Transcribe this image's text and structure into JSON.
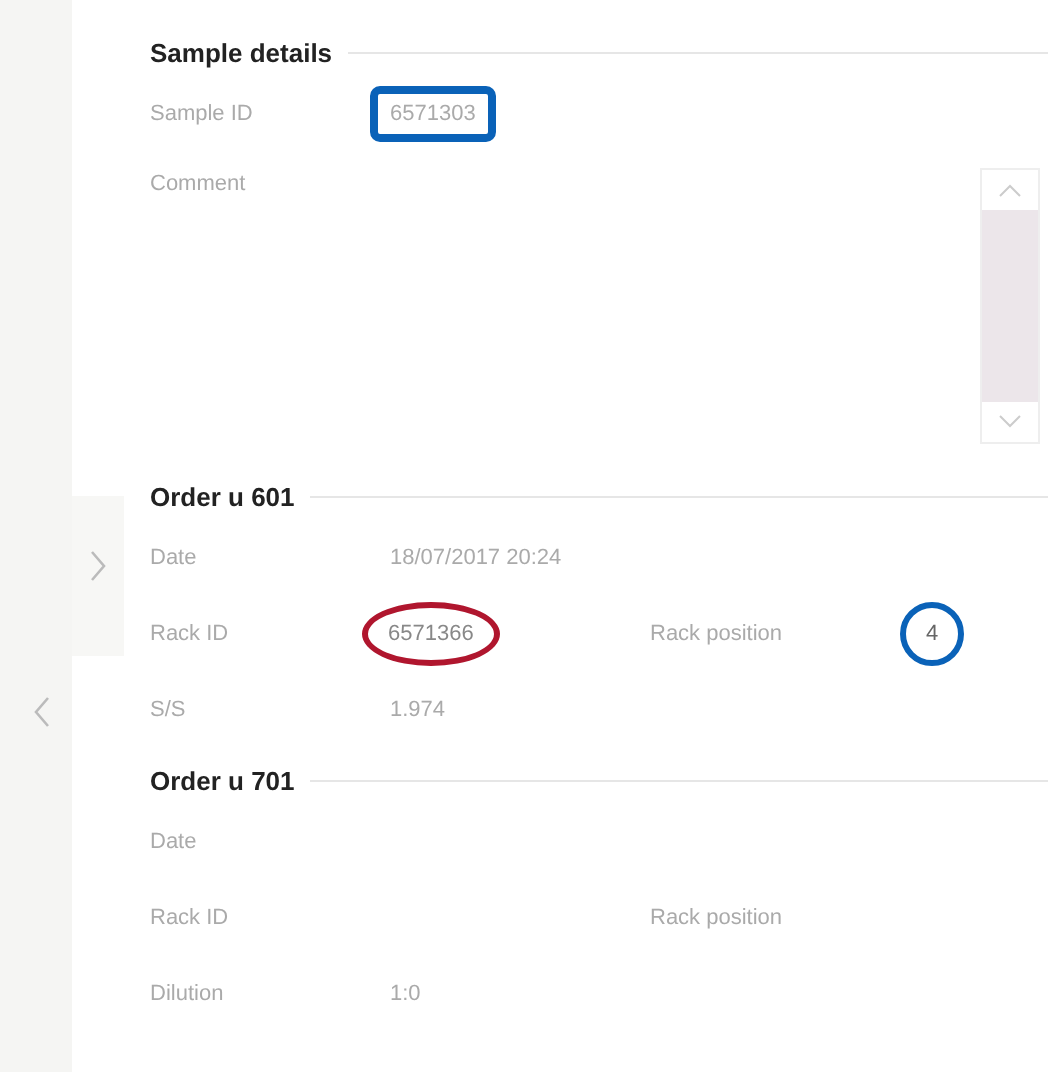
{
  "sections": [
    {
      "title": "Sample details",
      "rows": [
        {
          "kind": "pair",
          "label": "Sample ID",
          "value": "6571303",
          "mark": {
            "kind": "box",
            "color": "#0a62b8"
          }
        },
        {
          "kind": "comment",
          "label": "Comment"
        }
      ]
    },
    {
      "title": "Order u 601",
      "rows": [
        {
          "kind": "pair",
          "label": "Date",
          "value": "18/07/2017 20:24"
        },
        {
          "kind": "pair2",
          "label": "Rack ID",
          "value": "6571366",
          "mark": {
            "kind": "ellipse",
            "color": "#b0162e"
          },
          "label2": "Rack position",
          "value2": "4",
          "mark2": {
            "kind": "circle",
            "color": "#0a62b8"
          }
        },
        {
          "kind": "pair",
          "label": "S/S",
          "value": "1.974"
        }
      ]
    },
    {
      "title": "Order u 701",
      "rows": [
        {
          "kind": "pair",
          "label": "Date"
        },
        {
          "kind": "pair2",
          "label": "Rack ID",
          "label2": "Rack position"
        },
        {
          "kind": "pair",
          "label": "Dilution",
          "value": "1:0"
        }
      ]
    }
  ]
}
